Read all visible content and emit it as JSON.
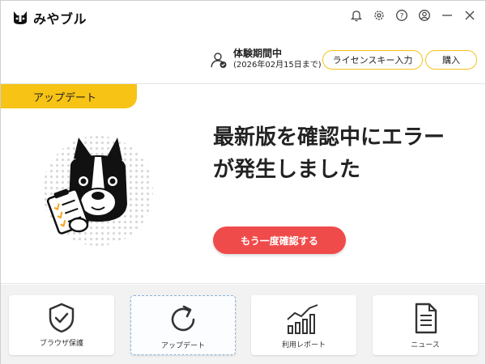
{
  "app": {
    "name": "みやブル"
  },
  "account": {
    "trial_status": "体験期間中",
    "trial_expiry": "(2026年02月15日まで)",
    "license_button": "ライセンスキー入力",
    "buy_button": "購入"
  },
  "section": {
    "title": "アップデート"
  },
  "message": {
    "line1": "最新版を確認中にエラー",
    "line2": "が発生しました"
  },
  "retry_button": "もう一度確認する",
  "nav": [
    {
      "label": "ブラウザ保護",
      "icon": "shield-check-icon"
    },
    {
      "label": "アップデート",
      "icon": "refresh-icon",
      "selected": true
    },
    {
      "label": "利用レポート",
      "icon": "bar-chart-icon"
    },
    {
      "label": "ニュース",
      "icon": "document-icon"
    }
  ],
  "colors": {
    "accent": "#f7c315",
    "danger": "#f04b4b",
    "nav_background": "#f2f2f2"
  }
}
